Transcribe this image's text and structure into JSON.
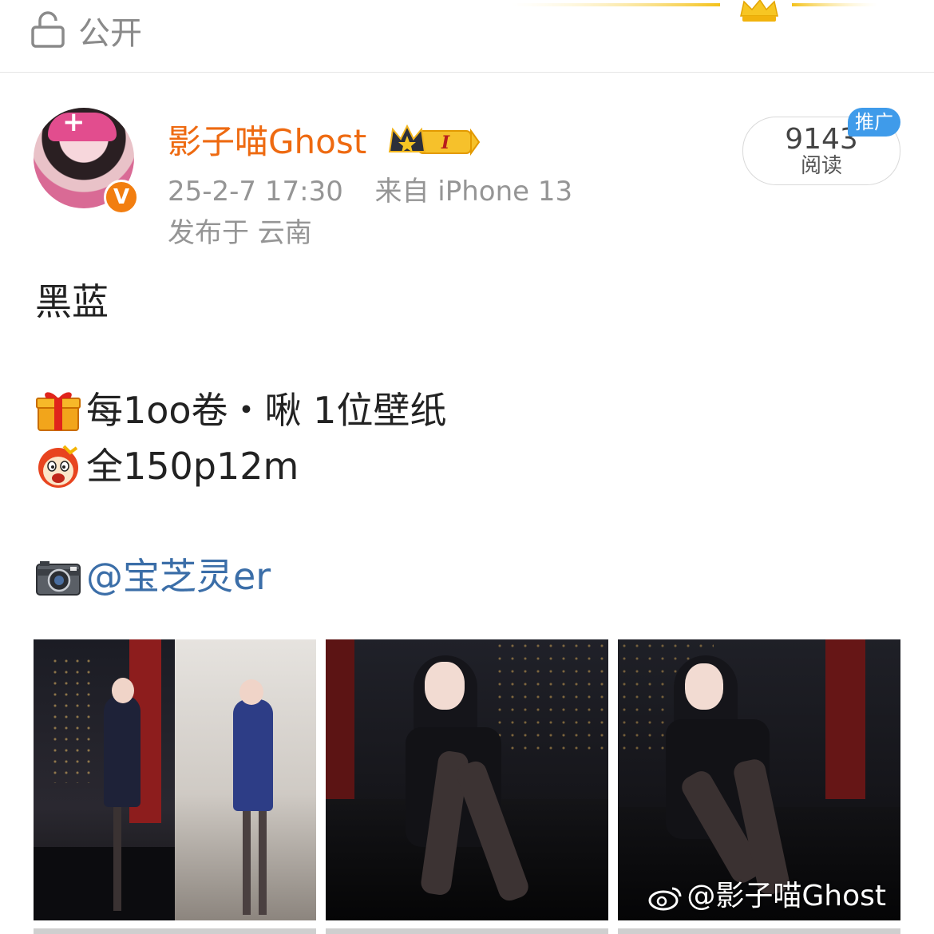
{
  "topbar": {
    "visibility_label": "公开"
  },
  "post": {
    "author": "影子喵Ghost",
    "level_badge": "I",
    "timestamp": "25-2-7 17:30",
    "source": "来自 iPhone 13",
    "location": "发布于 云南",
    "read_count": "9143",
    "read_label": "阅读",
    "promo_tag": "推广",
    "text": {
      "title": "黑蓝",
      "line_gift": "每1oo卷・啾 1位壁纸",
      "line_total": "全150p12m",
      "camera_prefix": "",
      "mention": "@宝芝灵er"
    },
    "images": [
      {
        "alt": "cosplay photo 1"
      },
      {
        "alt": "cosplay photo 2"
      },
      {
        "alt": "cosplay photo 3"
      }
    ],
    "watermark": "@影子喵Ghost"
  },
  "colors": {
    "username": "#ee6a11",
    "verified_badge": "#f27e10",
    "mention": "#3b6ea8",
    "promo_tag": "#3f9bea",
    "meta_text": "#959595"
  },
  "icons": [
    "lock-icon",
    "crown-icon",
    "verified-icon",
    "gift-emoji",
    "ghost-face-emoji",
    "camera-emoji",
    "weibo-logo-icon"
  ]
}
